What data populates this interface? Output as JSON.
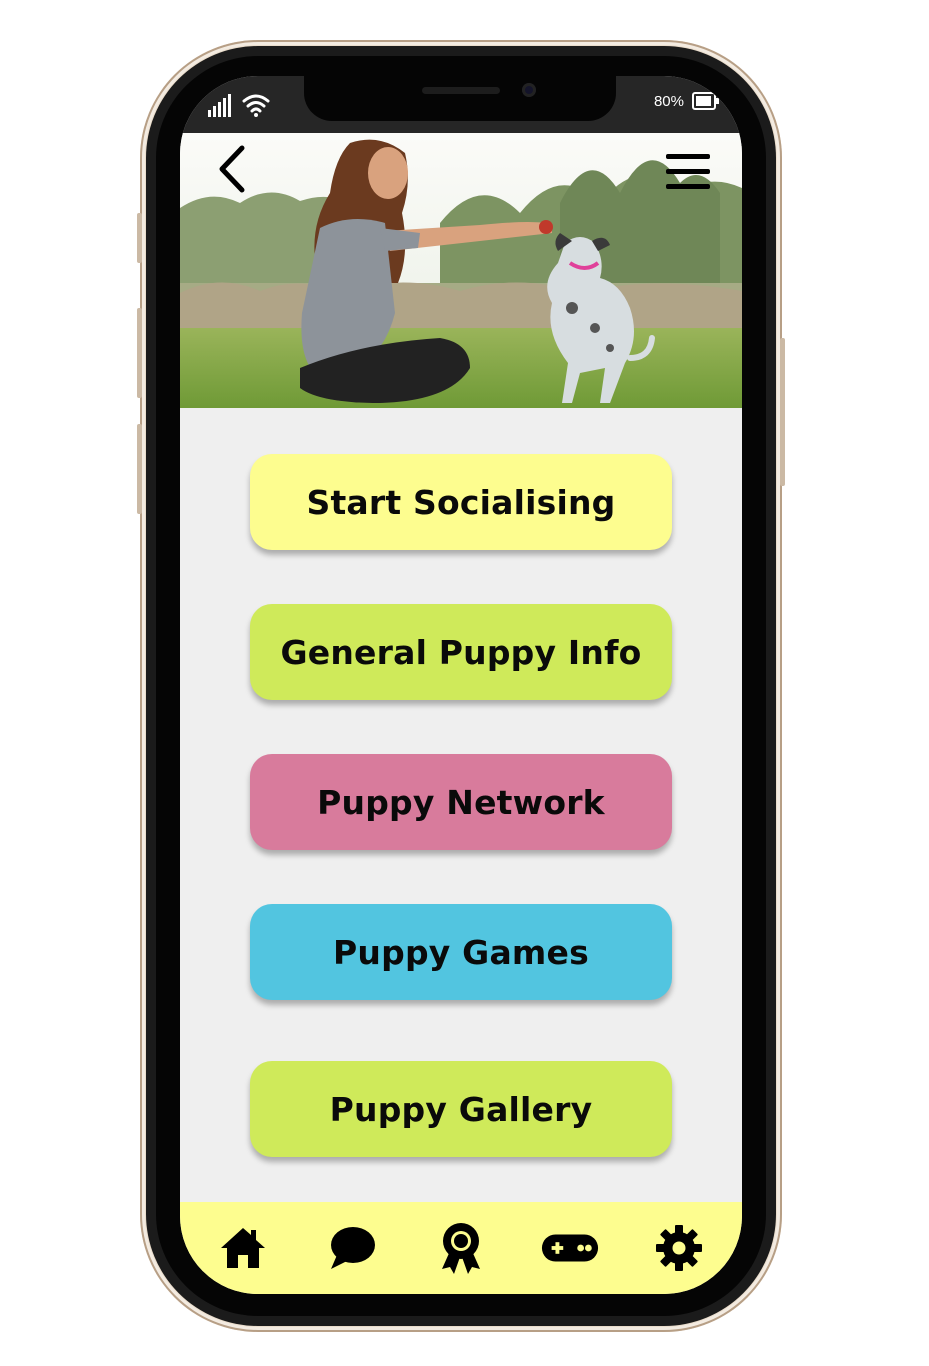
{
  "status_bar": {
    "battery_percent": "80%",
    "icons": [
      "signal-icon",
      "wifi-icon",
      "battery-icon"
    ]
  },
  "header": {
    "back_icon": "chevron-left-icon",
    "menu_icon": "hamburger-menu-icon",
    "photo": "girl-training-puppy-photo"
  },
  "menu": {
    "items": [
      {
        "label": "Start Socialising",
        "color": "#fdfd8f"
      },
      {
        "label": "General Puppy Info",
        "color": "#cfea5a"
      },
      {
        "label": "Puppy Network",
        "color": "#d87b9c"
      },
      {
        "label": "Puppy Games",
        "color": "#52c5e0"
      },
      {
        "label": "Puppy Gallery",
        "color": "#cfea5a"
      }
    ]
  },
  "bottom_nav": {
    "background": "#fdfd8f",
    "tabs": [
      "home-icon",
      "chat-icon",
      "award-ribbon-icon",
      "gamepad-icon",
      "settings-gear-icon"
    ]
  }
}
